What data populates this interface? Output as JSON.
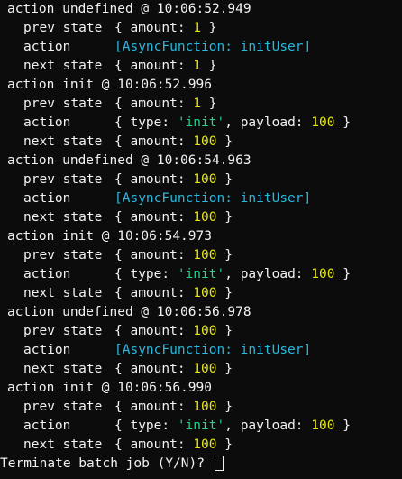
{
  "colors": {
    "background": "#0c0c0c",
    "text": "#f2f2f2",
    "number": "#e5e510",
    "string": "#23d18b",
    "function": "#29b8db"
  },
  "blocks": [
    {
      "action_line": "action undefined @ 10:06:52.949",
      "prev_label": "prev state",
      "prev_state": {
        "open": "{ amount: ",
        "value": "1",
        "close": " }"
      },
      "action_label": "action",
      "action_fn": "[AsyncFunction: initUser]",
      "next_label": "next state",
      "next_state": {
        "open": "{ amount: ",
        "value": "1",
        "close": " }"
      }
    },
    {
      "action_line": "action init @ 10:06:52.996",
      "prev_label": "prev state",
      "prev_state": {
        "open": "{ amount: ",
        "value": "1",
        "close": " }"
      },
      "action_label": "action",
      "action_obj": {
        "p1": "{ type: ",
        "type": "'init'",
        "p2": ", payload: ",
        "payload": "100",
        "p3": " }"
      },
      "next_label": "next state",
      "next_state": {
        "open": "{ amount: ",
        "value": "100",
        "close": " }"
      }
    },
    {
      "action_line": "action undefined @ 10:06:54.963",
      "prev_label": "prev state",
      "prev_state": {
        "open": "{ amount: ",
        "value": "100",
        "close": " }"
      },
      "action_label": "action",
      "action_fn": "[AsyncFunction: initUser]",
      "next_label": "next state",
      "next_state": {
        "open": "{ amount: ",
        "value": "100",
        "close": " }"
      }
    },
    {
      "action_line": "action init @ 10:06:54.973",
      "prev_label": "prev state",
      "prev_state": {
        "open": "{ amount: ",
        "value": "100",
        "close": " }"
      },
      "action_label": "action",
      "action_obj": {
        "p1": "{ type: ",
        "type": "'init'",
        "p2": ", payload: ",
        "payload": "100",
        "p3": " }"
      },
      "next_label": "next state",
      "next_state": {
        "open": "{ amount: ",
        "value": "100",
        "close": " }"
      }
    },
    {
      "action_line": "action undefined @ 10:06:56.978",
      "prev_label": "prev state",
      "prev_state": {
        "open": "{ amount: ",
        "value": "100",
        "close": " }"
      },
      "action_label": "action",
      "action_fn": "[AsyncFunction: initUser]",
      "next_label": "next state",
      "next_state": {
        "open": "{ amount: ",
        "value": "100",
        "close": " }"
      }
    },
    {
      "action_line": "action init @ 10:06:56.990",
      "prev_label": "prev state",
      "prev_state": {
        "open": "{ amount: ",
        "value": "100",
        "close": " }"
      },
      "action_label": "action",
      "action_obj": {
        "p1": "{ type: ",
        "type": "'init'",
        "p2": ", payload: ",
        "payload": "100",
        "p3": " }"
      },
      "next_label": "next state",
      "next_state": {
        "open": "{ amount: ",
        "value": "100",
        "close": " }"
      }
    }
  ],
  "prompt": "Terminate batch job (Y/N)? "
}
